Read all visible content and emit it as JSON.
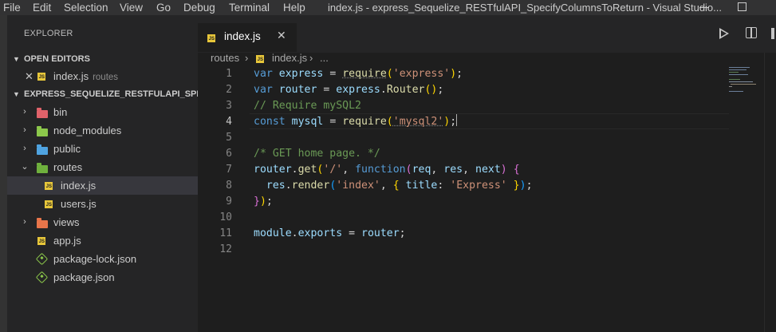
{
  "menu": [
    "File",
    "Edit",
    "Selection",
    "View",
    "Go",
    "Debug",
    "Terminal",
    "Help"
  ],
  "window_title": "index.js - express_Sequelize_RESTfulAPI_SpecifyColumnsToReturn - Visual Studio...",
  "sidebar": {
    "title": "EXPLORER",
    "open_editors_label": "OPEN EDITORS",
    "open_editor": {
      "close": "✕",
      "name": "index.js",
      "folder": "routes"
    },
    "project_label": "EXPRESS_SEQUELIZE_RESTFULAPI_SPE...",
    "items": [
      {
        "label": "bin",
        "icon": "folder-red-icon"
      },
      {
        "label": "node_modules",
        "icon": "folder-green-icon"
      },
      {
        "label": "public",
        "icon": "folder-blue-icon"
      },
      {
        "label": "routes",
        "icon": "folder-green-open-icon"
      },
      {
        "label": "index.js",
        "icon": "js-icon"
      },
      {
        "label": "users.js",
        "icon": "js-icon"
      },
      {
        "label": "views",
        "icon": "folder-orange-icon"
      },
      {
        "label": "app.js",
        "icon": "js-icon"
      },
      {
        "label": "package-lock.json",
        "icon": "nodejs-icon"
      },
      {
        "label": "package.json",
        "icon": "nodejs-icon"
      }
    ]
  },
  "tab": {
    "label": "index.js",
    "close": "✕"
  },
  "breadcrumb": {
    "folder": "routes",
    "file": "index.js",
    "more": "..."
  },
  "editor": {
    "line_numbers": [
      "1",
      "2",
      "3",
      "4",
      "5",
      "6",
      "7",
      "8",
      "9",
      "10",
      "11",
      "12"
    ],
    "active_line": "4",
    "lines": [
      "var express = require('express');",
      "var router = express.Router();",
      "// Require mySQL2",
      "const mysql = require('mysql2');",
      "",
      "/* GET home page. */",
      "router.get('/', function(req, res, next) {",
      "  res.render('index', { title: 'Express' });",
      "});",
      "",
      "module.exports = router;",
      ""
    ]
  },
  "colors": {
    "keyword": "#569cd6",
    "variable": "#9cdcfe",
    "function": "#dcdcaa",
    "string": "#ce9178",
    "comment": "#6a9955",
    "js_icon": "#e8c73a",
    "selection": "#37373d"
  }
}
